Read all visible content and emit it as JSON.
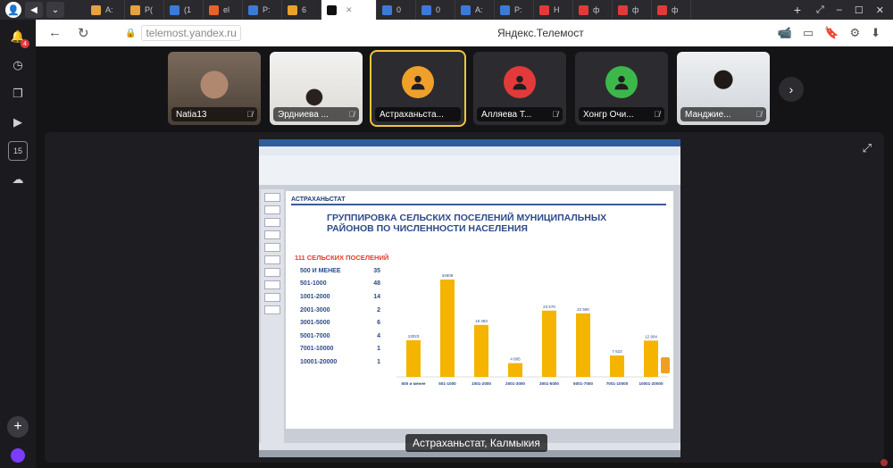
{
  "browser": {
    "title": "Яндекс.Телемост",
    "url": "telemost.yandex.ru",
    "tabs": [
      {
        "label": "A:",
        "color": "#e6a23c"
      },
      {
        "label": "P(",
        "color": "#e6a23c"
      },
      {
        "label": "(1",
        "color": "#3b7bd8"
      },
      {
        "label": "el",
        "color": "#e8622a"
      },
      {
        "label": "P:",
        "color": "#3b7bd8"
      },
      {
        "label": "6",
        "color": "#e8a42a"
      },
      {
        "label": "",
        "color": "#111111",
        "active": true
      },
      {
        "label": "0",
        "color": "#3b7bd8"
      },
      {
        "label": "0",
        "color": "#3b7bd8"
      },
      {
        "label": "A:",
        "color": "#3b7bd8"
      },
      {
        "label": "P:",
        "color": "#3b7bd8"
      },
      {
        "label": "H",
        "color": "#e23a3a"
      },
      {
        "label": "ф",
        "color": "#e23a3a"
      },
      {
        "label": "ф",
        "color": "#e23a3a"
      },
      {
        "label": "ф",
        "color": "#e23a3a"
      }
    ]
  },
  "sidebar": {
    "notification_badge": "4",
    "items": [
      "bell",
      "history",
      "collections",
      "video",
      "calendar-15",
      "cloud"
    ]
  },
  "participants": [
    {
      "name": "Natia13",
      "avatar": "photo",
      "muted": true
    },
    {
      "name": "Эрдниева ...",
      "avatar": "photo",
      "muted": true
    },
    {
      "name": "Астраханьста...",
      "avatar": "icon",
      "color": "#f0a02a",
      "speaking": true,
      "muted": false
    },
    {
      "name": "Алляева Т...",
      "avatar": "icon",
      "color": "#e23a3a",
      "muted": true
    },
    {
      "name": "Хонгр Очи...",
      "avatar": "icon",
      "color": "#3cb84a",
      "muted": true
    },
    {
      "name": "Манджие...",
      "avatar": "photo",
      "muted": true
    }
  ],
  "screen_share": {
    "caption": "Астраханьстат, Калмыкия",
    "slide": {
      "brand": "АСТРАХАНЬСТАТ",
      "title": "ГРУППИРОВКА СЕЛЬСКИХ ПОСЕЛЕНИЙ МУНИЦИПАЛЬНЫХ РАЙОНОВ ПО ЧИСЛЕННОСТИ НАСЕЛЕНИЯ",
      "subtitle": "111 СЕЛЬСКИХ ПОСЕЛЕНИЙ",
      "groups": [
        {
          "label": "500 И МЕНЕЕ",
          "count": "35"
        },
        {
          "label": "501-1000",
          "count": "48"
        },
        {
          "label": "1001-2000",
          "count": "14"
        },
        {
          "label": "2001-3000",
          "count": "2"
        },
        {
          "label": "3001-5000",
          "count": "6"
        },
        {
          "label": "5001-7000",
          "count": "4"
        },
        {
          "label": "7001-10000",
          "count": "1"
        },
        {
          "label": "10001-20000",
          "count": "1"
        }
      ]
    }
  },
  "chart_data": {
    "type": "bar",
    "categories": [
      "500 и менее",
      "501-1000",
      "1001-2000",
      "2001-3000",
      "3001-5000",
      "5001-7000",
      "7001-10000",
      "10001-20000"
    ],
    "values": [
      13023,
      34608,
      18483,
      4895,
      23570,
      22590,
      7623,
      12904
    ],
    "data_labels": [
      "13023",
      "34608",
      "18 483",
      "4 895",
      "23 570",
      "22 590",
      "7 623",
      "12 904"
    ],
    "ylim": [
      0,
      40000
    ],
    "bar_color": "#f5b400",
    "grid": false
  }
}
